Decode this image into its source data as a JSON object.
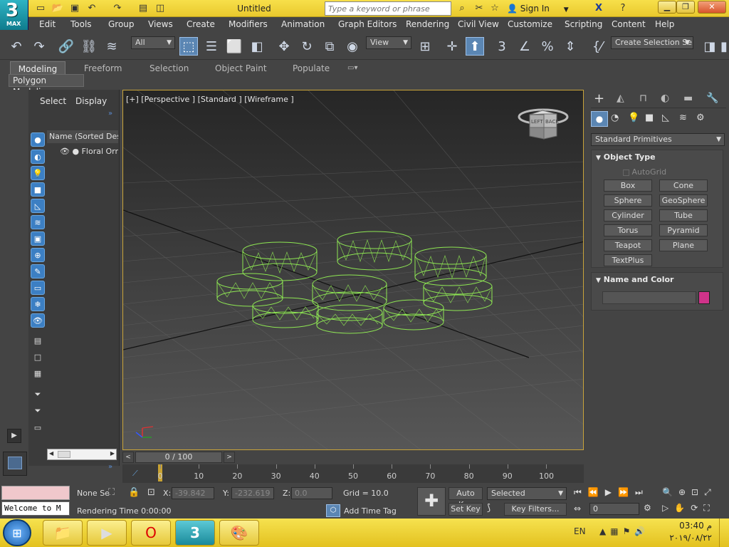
{
  "app": {
    "logo_number": "3",
    "logo_sub": "MAX",
    "doc_title": "Untitled"
  },
  "search": {
    "placeholder": "Type a keyword or phrase"
  },
  "account": {
    "sign_in": "Sign In"
  },
  "menu": [
    "Edit",
    "Tools",
    "Group",
    "Views",
    "Create",
    "Modifiers",
    "Animation",
    "Graph Editors",
    "Rendering",
    "Civil View",
    "Customize",
    "Scripting",
    "Content",
    "Help"
  ],
  "toolbar": {
    "filter_value": "All",
    "ref_coord_value": "View",
    "selection_set_value": "Create Selection Se"
  },
  "ribbon": {
    "tabs": [
      "Modeling",
      "Freeform",
      "Selection",
      "Object Paint",
      "Populate"
    ],
    "subpanel": "Polygon Modeling"
  },
  "explorer": {
    "tabs": [
      "Select",
      "Display"
    ],
    "column_header": "Name (Sorted Desce",
    "item": "Floral Orn"
  },
  "viewport": {
    "label": "[+] [Perspective ] [Standard ] [Wireframe ]",
    "viewcube_left": "LEFT",
    "viewcube_back": "BACK"
  },
  "command_panel": {
    "category": "Standard Primitives",
    "object_type_title": "Object Type",
    "autogrid": "AutoGrid",
    "buttons": [
      "Box",
      "Cone",
      "Sphere",
      "GeoSphere",
      "Cylinder",
      "Tube",
      "Torus",
      "Pyramid",
      "Teapot",
      "Plane",
      "TextPlus"
    ],
    "name_color_title": "Name and Color",
    "swatch_color": "#d0338a"
  },
  "timeline": {
    "position": "0 / 100",
    "ticks": [
      "0",
      "10",
      "20",
      "30",
      "40",
      "50",
      "60",
      "70",
      "80",
      "90",
      "100"
    ]
  },
  "status": {
    "selection": "None Se",
    "x_label": "X:",
    "x_value": "-39.842",
    "y_label": "Y:",
    "y_value": "-232.619",
    "z_label": "Z:",
    "z_value": "0.0",
    "grid": "Grid = 10.0",
    "add_time_tag": "Add Time Tag",
    "rendering_time": "Rendering Time  0:00:00",
    "welcome": "Welcome to M",
    "auto_key": "Auto Key",
    "set_key": "Set Key",
    "key_mode_value": "Selected",
    "key_filters": "Key Filters...",
    "frame_value": "0"
  },
  "taskbar": {
    "lang": "EN",
    "time": "03:40 م",
    "date": "٢٠١٩/٠٨/٢٢"
  },
  "colors": {
    "wireframe": "#8ee653",
    "viewport_border": "#c9a43a",
    "title_bar": "#f0d33a"
  }
}
